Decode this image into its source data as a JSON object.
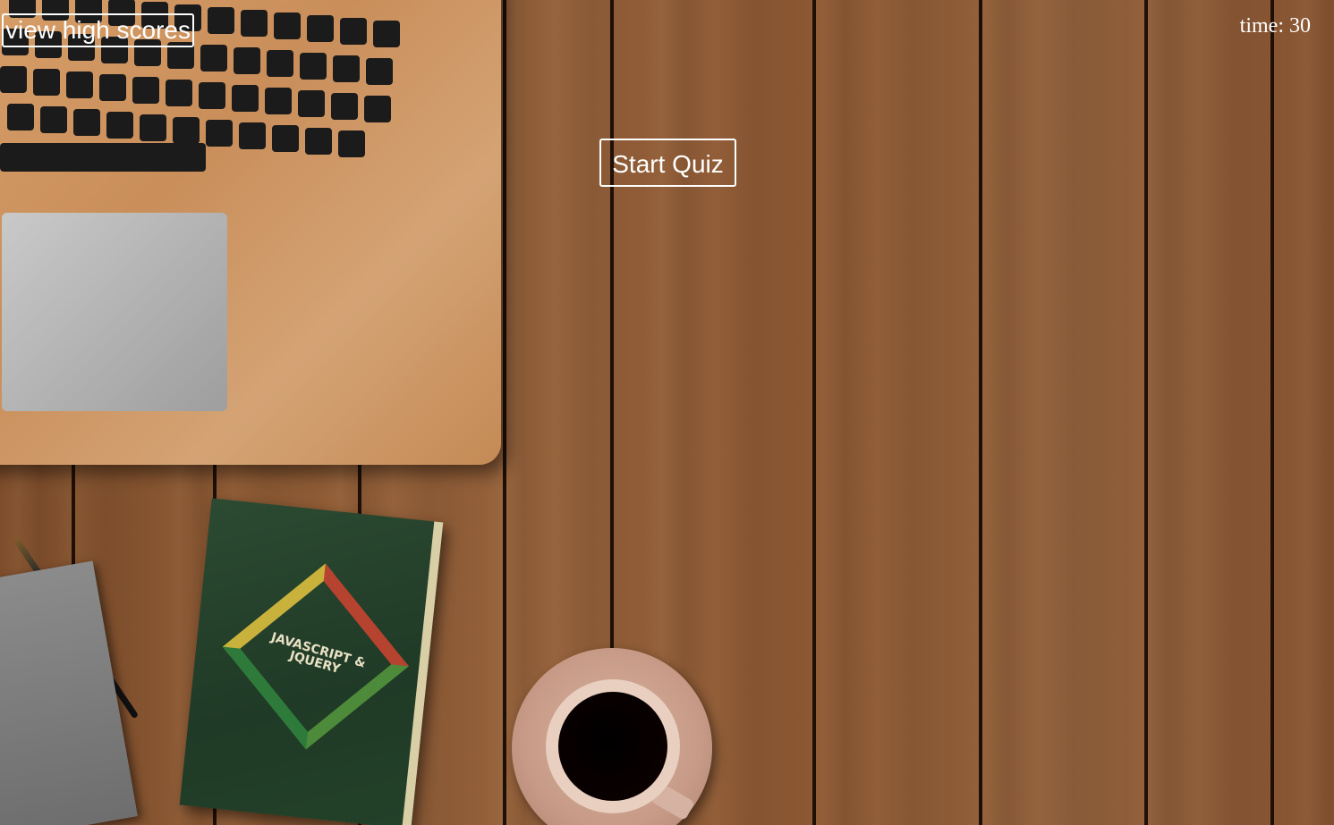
{
  "header": {
    "high_scores_label": "view high scores",
    "timer_label": "time:",
    "timer_value": "30"
  },
  "main": {
    "start_label": "Start Quiz"
  },
  "background": {
    "book_title": "JAVASCRIPT & JQUERY"
  },
  "colors": {
    "button_border": "#ffffff",
    "text": "#ffffff",
    "wood": "#8a5530"
  }
}
